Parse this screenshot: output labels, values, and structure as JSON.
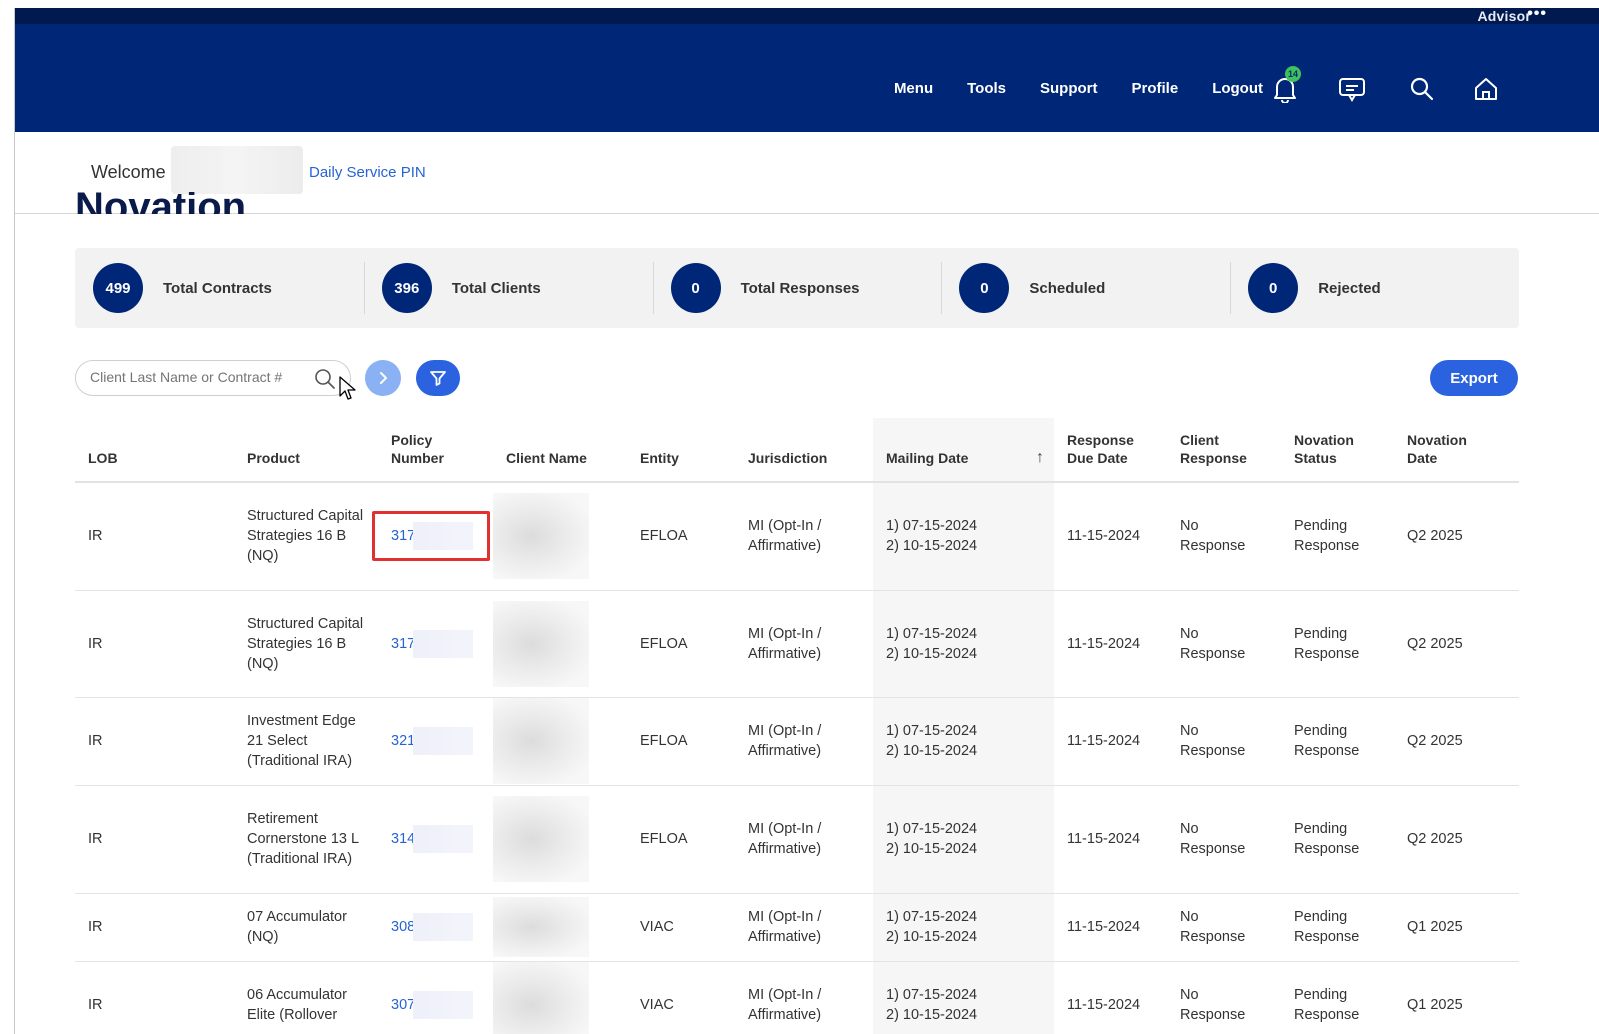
{
  "header": {
    "role_label": "Advisor",
    "more": "•••",
    "nav": [
      "Menu",
      "Tools",
      "Support",
      "Profile",
      "Logout"
    ],
    "notification_count": "14"
  },
  "welcome": {
    "greeting": "Welcome",
    "pin_link": "Daily Service PIN",
    "page_title": "Novation"
  },
  "stats": [
    {
      "value": "499",
      "label": "Total Contracts"
    },
    {
      "value": "396",
      "label": "Total Clients"
    },
    {
      "value": "0",
      "label": "Total Responses"
    },
    {
      "value": "0",
      "label": "Scheduled"
    },
    {
      "value": "0",
      "label": "Rejected"
    }
  ],
  "toolbar": {
    "search_placeholder": "Client Last Name or Contract #",
    "export_label": "Export"
  },
  "table": {
    "columns": [
      "LOB",
      "Product",
      "Policy Number",
      "Client Name",
      "Entity",
      "Jurisdiction",
      "Mailing Date",
      "Response Due Date",
      "Client Response",
      "Novation Status",
      "Novation Date"
    ],
    "rows": [
      {
        "lob": "IR",
        "product": "Structured Capital Strategies 16 B (NQ)",
        "policy": "317",
        "entity": "EFLOA",
        "jurisdiction": "MI (Opt-In / Affirmative)",
        "mailing_1": "1) 07-15-2024",
        "mailing_2": "2) 10-15-2024",
        "due": "11-15-2024",
        "response": "No Response",
        "status": "Pending Response",
        "date": "Q2 2025"
      },
      {
        "lob": "IR",
        "product": "Structured Capital Strategies 16 B (NQ)",
        "policy": "317",
        "entity": "EFLOA",
        "jurisdiction": "MI (Opt-In / Affirmative)",
        "mailing_1": "1) 07-15-2024",
        "mailing_2": "2) 10-15-2024",
        "due": "11-15-2024",
        "response": "No Response",
        "status": "Pending Response",
        "date": "Q2 2025"
      },
      {
        "lob": "IR",
        "product": "Investment Edge 21 Select (Traditional IRA)",
        "policy": "321",
        "entity": "EFLOA",
        "jurisdiction": "MI (Opt-In / Affirmative)",
        "mailing_1": "1) 07-15-2024",
        "mailing_2": "2) 10-15-2024",
        "due": "11-15-2024",
        "response": "No Response",
        "status": "Pending Response",
        "date": "Q2 2025"
      },
      {
        "lob": "IR",
        "product": "Retirement Cornerstone 13 L (Traditional IRA)",
        "policy": "314",
        "entity": "EFLOA",
        "jurisdiction": "MI (Opt-In / Affirmative)",
        "mailing_1": "1) 07-15-2024",
        "mailing_2": "2) 10-15-2024",
        "due": "11-15-2024",
        "response": "No Response",
        "status": "Pending Response",
        "date": "Q2 2025"
      },
      {
        "lob": "IR",
        "product": "07 Accumulator (NQ)",
        "policy": "308",
        "entity": "VIAC",
        "jurisdiction": "MI (Opt-In / Affirmative)",
        "mailing_1": "1) 07-15-2024",
        "mailing_2": "2) 10-15-2024",
        "due": "11-15-2024",
        "response": "No Response",
        "status": "Pending Response",
        "date": "Q1 2025"
      },
      {
        "lob": "IR",
        "product": "06 Accumulator Elite (Rollover",
        "policy": "307",
        "entity": "VIAC",
        "jurisdiction": "MI (Opt-In / Affirmative)",
        "mailing_1": "1) 07-15-2024",
        "mailing_2": "2) 10-15-2024",
        "due": "11-15-2024",
        "response": "No Response",
        "status": "Pending Response",
        "date": "Q1 2025"
      }
    ]
  }
}
